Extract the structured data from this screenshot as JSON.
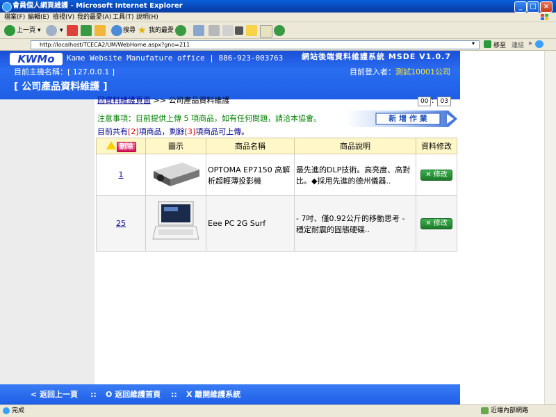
{
  "window": {
    "title": "會員個人網頁維護 - Microsoft Internet Explorer"
  },
  "menu": [
    "檔案(F)",
    "編輯(E)",
    "檢視(V)",
    "我的最愛(A)",
    "工具(T)",
    "說明(H)"
  ],
  "toolbar": {
    "back": "上一頁",
    "search": "搜尋",
    "favorites": "我的最愛"
  },
  "address": {
    "url": "http://localhost/TCECA2/UM/WebHome.aspx?gno=211",
    "go": "移至",
    "links": "連結"
  },
  "header": {
    "logo": "KWMo",
    "tagline": "Kame Website Manufature office | 886-923-003763",
    "system": "網站後端資料維護系統 MSDE V1.0.7",
    "host_label": "目前主機名稱：[ 127.0.0.1 ]",
    "login_label": "目前登入者：",
    "login_user": "測試10001公司",
    "page_title": "[ 公司產品資料維護 ]"
  },
  "main": {
    "breadcrumb_link": "回資料維護頁面",
    "breadcrumb_sep": " >> ",
    "breadcrumb_current": "公司產品資料維護",
    "timer_min": "00",
    "timer_sep": "：",
    "timer_sec": "03",
    "notice": "注意事項：目前提供上傳 5 項商品，如有任何問題，請洽本協會。",
    "add_button": "新 增 作 業",
    "count_prefix": "目前共有",
    "count_total": "[2]",
    "count_mid": "項商品，剩餘",
    "count_remaining": "[3]",
    "count_suffix": "項商品可上傳。"
  },
  "table": {
    "headers": {
      "delete": "刪除",
      "image": "圖示",
      "name": "商品名稱",
      "desc": "商品說明",
      "edit": "資料修改"
    },
    "rows": [
      {
        "id": "1",
        "name": "OPTOMA EP7150 高解析超輕薄投影機",
        "desc": "最先進的DLP技術。高亮度、高對比。◆採用先進的德州儀器..",
        "edit": "修改"
      },
      {
        "id": "25",
        "name": "Eee PC 2G Surf",
        "desc": "- 7吋、僅0.92公斤的移動思考 - 穩定耐震的固態硬碟..",
        "edit": "修改"
      }
    ]
  },
  "footer": {
    "back": "< 返回上一頁",
    "sep": "::",
    "home": "O 返回維護首頁",
    "exit": "X 離開維護系統"
  },
  "status": {
    "left": "完成",
    "right": "近端內部網路"
  },
  "colors": {
    "header_blue": "#2a6df0",
    "notice_green": "#008000",
    "accent_red": "#d40000"
  }
}
